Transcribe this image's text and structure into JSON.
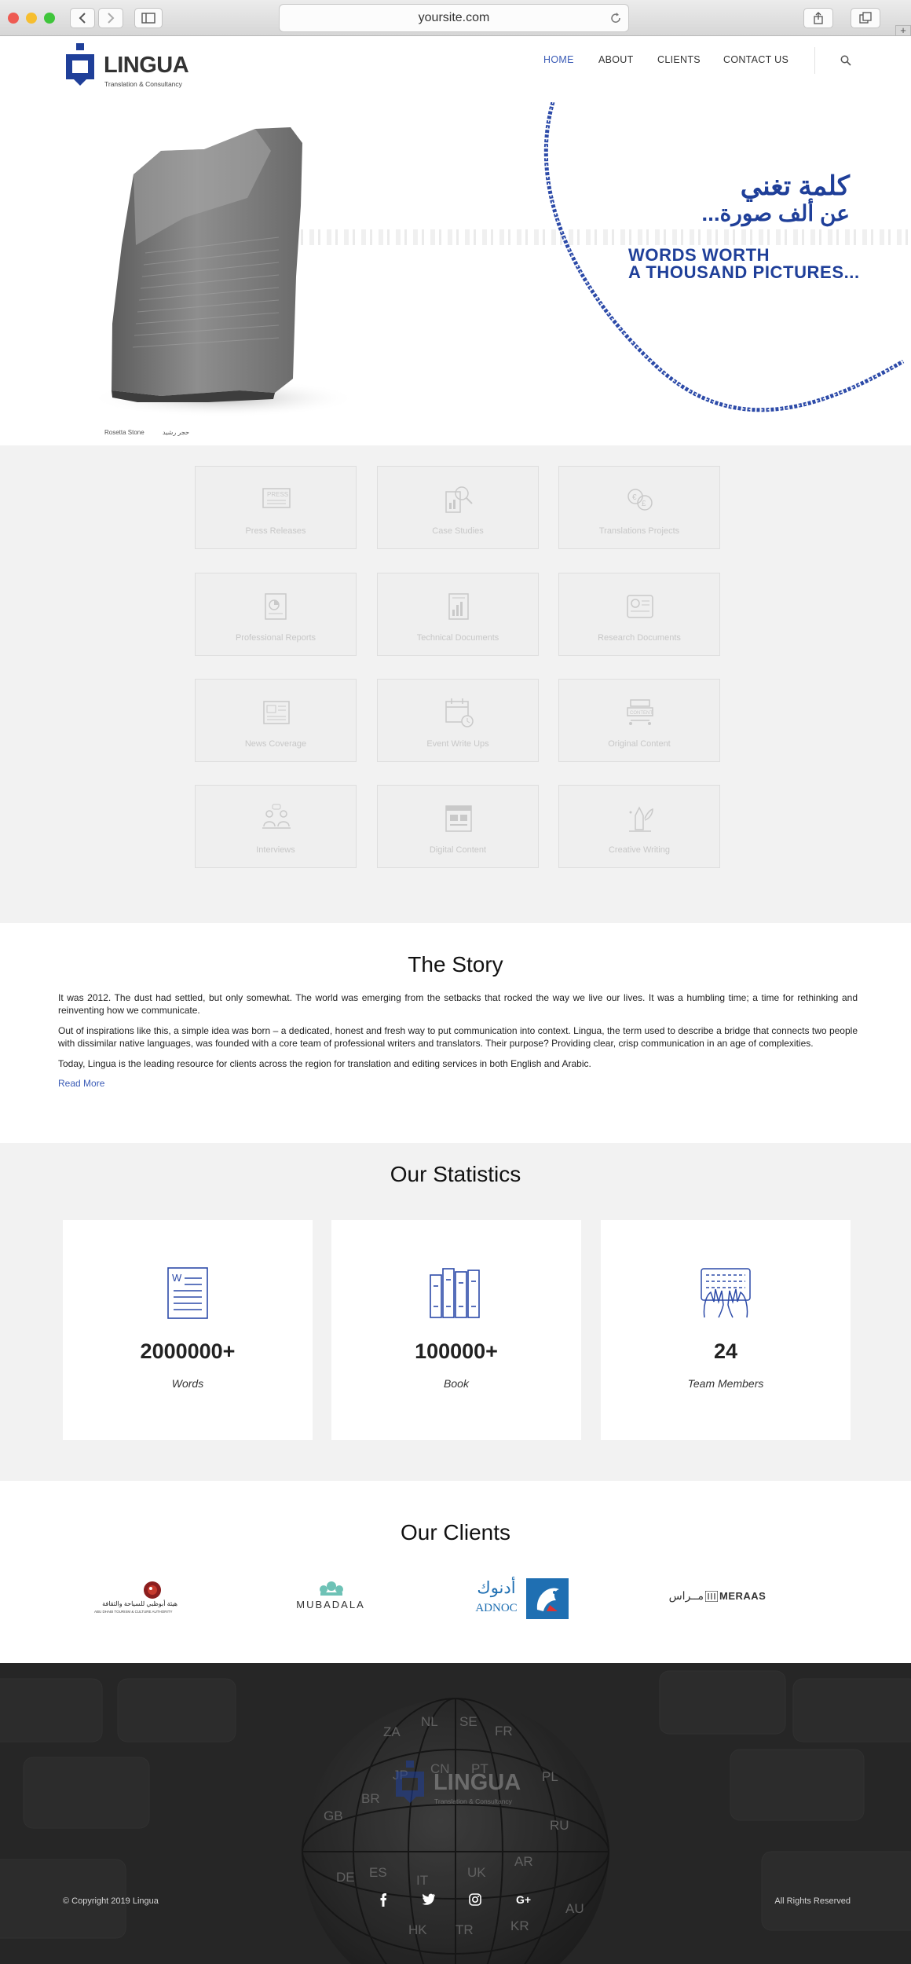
{
  "browser": {
    "url": "yoursite.com",
    "colors": {
      "close": "#ee5a52",
      "minimize": "#f6be2f",
      "maximize": "#3fc53b"
    }
  },
  "header": {
    "logo_name": "LINGUA",
    "logo_tagline": "Translation & Consultancy",
    "nav": [
      {
        "label": "HOME",
        "active": true
      },
      {
        "label": "ABOUT",
        "active": false
      },
      {
        "label": "CLIENTS",
        "active": false
      },
      {
        "label": "CONTACT US",
        "active": false
      }
    ],
    "accent_color": "#1f3f99"
  },
  "hero": {
    "arabic_line1": "كلمة تغني",
    "arabic_line2": "عن ألف صورة...",
    "english_line1": "WORDS WORTH",
    "english_line2": "A THOUSAND PICTURES...",
    "caption_en": "Rosetta Stone",
    "caption_ar": "حجر رشيد"
  },
  "services": [
    {
      "label": "Press Releases",
      "icon": "press-release-icon"
    },
    {
      "label": "Case Studies",
      "icon": "case-study-icon"
    },
    {
      "label": "Translations Projects",
      "icon": "translation-icon"
    },
    {
      "label": "Professional Reports",
      "icon": "report-icon"
    },
    {
      "label": "Technical Documents",
      "icon": "technical-document-icon"
    },
    {
      "label": "Research Documents",
      "icon": "research-document-icon"
    },
    {
      "label": "News Coverage",
      "icon": "newspaper-icon"
    },
    {
      "label": "Event Write Ups",
      "icon": "calendar-icon"
    },
    {
      "label": "Original Content",
      "icon": "content-icon"
    },
    {
      "label": "Interviews",
      "icon": "interview-icon"
    },
    {
      "label": "Digital Content",
      "icon": "digital-content-icon"
    },
    {
      "label": "Creative Writing",
      "icon": "creative-writing-icon"
    }
  ],
  "story": {
    "title": "The Story",
    "p1": "It was 2012. The dust had settled, but only somewhat. The world was emerging from the setbacks that rocked the way we live our lives. It was a humbling time; a time for rethinking and reinventing how we communicate.",
    "p2": "Out of inspirations like this, a simple idea was born – a dedicated, honest and fresh way to put communication into context. Lingua, the term used to describe a bridge that connects two people with dissimilar native languages, was founded with a core team of professional writers and translators. Their purpose? Providing clear, crisp communication in an age of complexities.",
    "p3": "Today, Lingua is the leading resource for clients across the region for translation and editing services in both English and Arabic.",
    "read_more": "Read More"
  },
  "statistics": {
    "title": "Our Statistics",
    "items": [
      {
        "number": "2000000+",
        "label": "Words",
        "icon": "document-icon"
      },
      {
        "number": "100000+",
        "label": "Book",
        "icon": "books-icon"
      },
      {
        "number": "24",
        "label": "Team Members",
        "icon": "typing-hands-icon"
      }
    ]
  },
  "clients": {
    "title": "Our Clients",
    "logos": [
      {
        "ar": "هيئة أبوظبي للسياحة والثقافة",
        "en": "ABU DHABI TOURISM & CULTURE AUTHORITY"
      },
      {
        "en": "MUBADALA"
      },
      {
        "ar": "أدنوك",
        "en": "ADNOC"
      },
      {
        "ar": "مــراس",
        "en": "MERAAS"
      }
    ]
  },
  "footer": {
    "logo_name": "LINGUA",
    "logo_tagline": "Translation & Consultancy",
    "copyright": "© Copyright 2019 Lingua",
    "rights": "All Rights Reserved",
    "social": [
      "facebook-icon",
      "twitter-icon",
      "instagram-icon",
      "google-plus-icon"
    ],
    "globe_keys": [
      "ZA",
      "NL",
      "SE",
      "FR",
      "JP",
      "CN",
      "PT",
      "BR",
      "GB",
      "DE",
      "ES",
      "IT",
      "UK",
      "AR",
      "PL",
      "RU",
      "AU",
      "KR",
      "TR",
      "HK"
    ]
  }
}
